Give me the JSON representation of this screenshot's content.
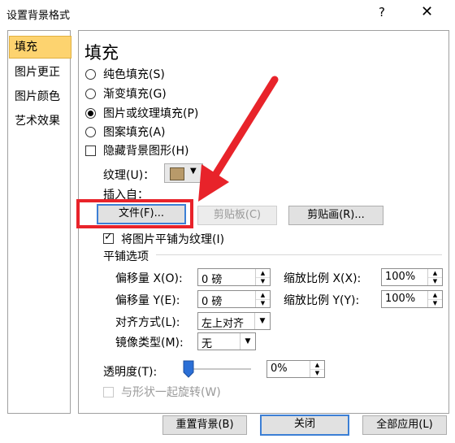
{
  "window": {
    "title": "设置背景格式",
    "help": "?",
    "close": "✕"
  },
  "sidebar": {
    "items": [
      {
        "label": "填充"
      },
      {
        "label": "图片更正"
      },
      {
        "label": "图片颜色"
      },
      {
        "label": "艺术效果"
      }
    ]
  },
  "fill": {
    "heading": "填充",
    "solid": "纯色填充(S)",
    "gradient": "渐变填充(G)",
    "picture": "图片或纹理填充(P)",
    "pattern": "图案填充(A)",
    "hide_bg": "隐藏背景图形(H)",
    "texture_label": "纹理(U)：",
    "insert_from": "插入自：",
    "file_btn": "文件(F)...",
    "clipboard_btn": "剪贴板(C)",
    "clipart_btn": "剪贴画(R)...",
    "tile": "将图片平铺为纹理(I)"
  },
  "tiling": {
    "heading": "平铺选项",
    "offset_x_label": "偏移量 X(O):",
    "offset_x": "0 磅",
    "scale_x_label": "缩放比例 X(X):",
    "scale_x": "100%",
    "offset_y_label": "偏移量 Y(E):",
    "offset_y": "0 磅",
    "scale_y_label": "缩放比例 Y(Y):",
    "scale_y": "100%",
    "align_label": "对齐方式(L):",
    "align_value": "左上对齐",
    "mirror_label": "镜像类型(M):",
    "mirror_value": "无"
  },
  "transparency": {
    "label": "透明度(T):",
    "value": "0%",
    "level": 0
  },
  "rotate_with_shape": "与形状一起旋转(W)",
  "footer": {
    "reset": "重置背景(B)",
    "close": "关闭",
    "apply_all": "全部应用(L)"
  },
  "colors": {
    "accent_selected": "#fdd36f",
    "annotation": "#e8232a"
  }
}
